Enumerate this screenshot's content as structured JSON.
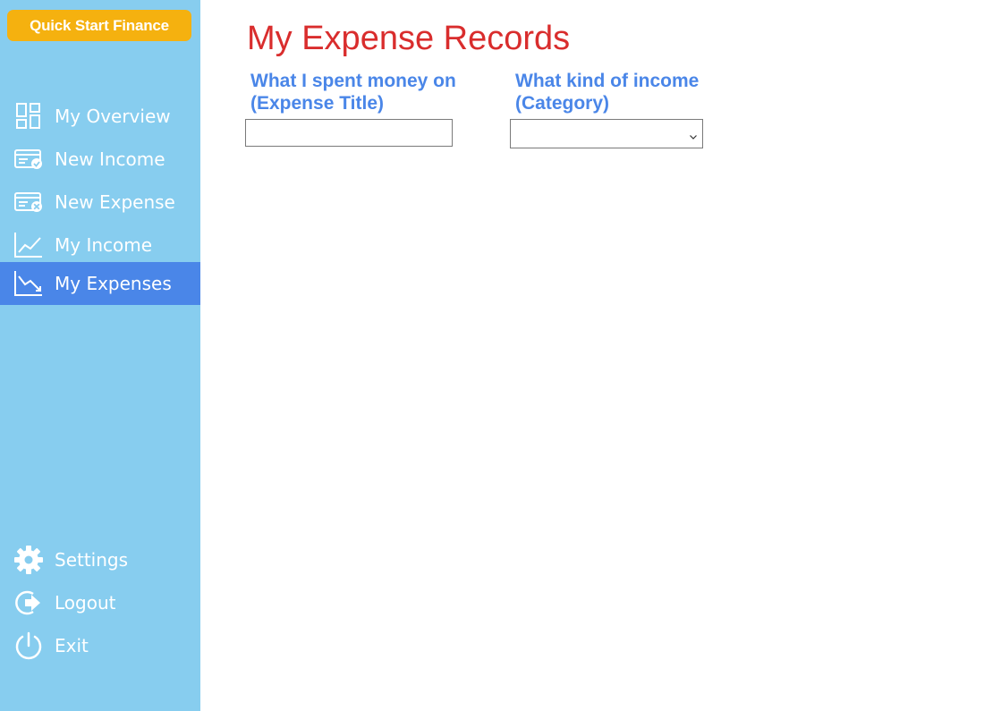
{
  "app": {
    "brand": "Quick Start Finance"
  },
  "sidebar": {
    "items": [
      {
        "label": "My Overview",
        "icon": "dashboard-icon"
      },
      {
        "label": "New Income",
        "icon": "card-check-icon"
      },
      {
        "label": "New Expense",
        "icon": "card-minus-icon"
      },
      {
        "label": "My Income",
        "icon": "chart-up-icon"
      },
      {
        "label": "My Expenses",
        "icon": "chart-down-icon",
        "active": true
      }
    ],
    "footer_items": [
      {
        "label": "Settings",
        "icon": "gear-icon"
      },
      {
        "label": "Logout",
        "icon": "logout-icon"
      },
      {
        "label": "Exit",
        "icon": "power-icon"
      }
    ]
  },
  "main": {
    "title": "My Expense Records",
    "fields": {
      "title_field": {
        "label_line1": "What I spent money on",
        "label_line2": "(Expense Title)",
        "value": "",
        "placeholder": ""
      },
      "category_field": {
        "label_line1": "What kind of income",
        "label_line2": "(Category)",
        "selected": ""
      }
    }
  },
  "colors": {
    "sidebar_bg": "#87cdef",
    "active_bg": "#4a86e8",
    "brand_bg": "#f5b10f",
    "title": "#d92d2d",
    "label": "#4a86e8"
  }
}
